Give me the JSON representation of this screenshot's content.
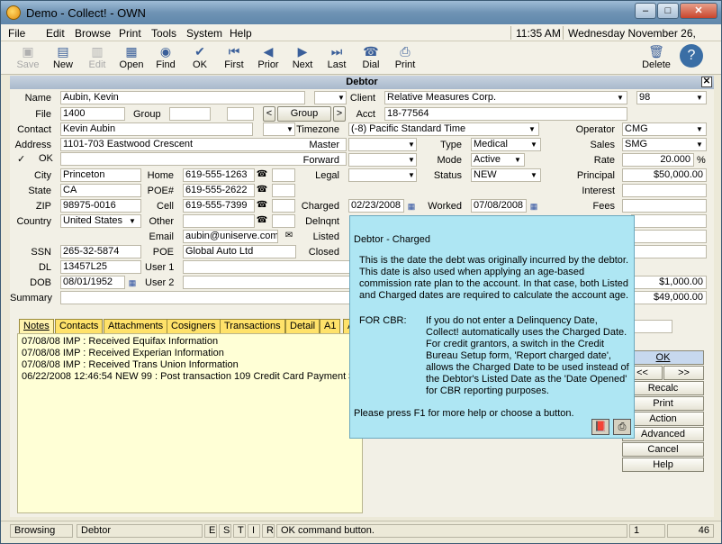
{
  "window": {
    "title": "Demo - Collect! - OWN",
    "min": "–",
    "max": "□",
    "close": "✕"
  },
  "menu": {
    "items": [
      "File",
      "Edit",
      "Browse",
      "Print",
      "Tools",
      "System",
      "Help"
    ],
    "time": "11:35 AM",
    "date": "Wednesday  November 26, 2008"
  },
  "toolbar": {
    "save": "Save",
    "new": "New",
    "edit": "Edit",
    "open": "Open",
    "find": "Find",
    "ok": "OK",
    "first": "First",
    "prior": "Prior",
    "next": "Next",
    "last": "Last",
    "dial": "Dial",
    "print": "Print",
    "delete": "Delete",
    "help": "?"
  },
  "panel": {
    "title": "Debtor",
    "close": "✕"
  },
  "labels": {
    "name": "Name",
    "file": "File",
    "group": "Group",
    "contact": "Contact",
    "address": "Address",
    "ok": "OK",
    "city": "City",
    "home": "Home",
    "state": "State",
    "poe_num": "POE#",
    "zip": "ZIP",
    "cell": "Cell",
    "country": "Country",
    "other": "Other",
    "email": "Email",
    "ssn": "SSN",
    "poe": "POE",
    "dl": "DL",
    "user1": "User 1",
    "dob": "DOB",
    "user2": "User 2",
    "summary": "Summary",
    "client": "Client",
    "acct": "Acct",
    "timezone": "Timezone",
    "master": "Master",
    "forward": "Forward",
    "legal": "Legal",
    "charged": "Charged",
    "delnqnt": "Delnqnt",
    "listed": "Listed",
    "closed": "Closed",
    "type": "Type",
    "mode": "Mode",
    "status": "Status",
    "worked": "Worked",
    "operator": "Operator",
    "sales": "Sales",
    "rate": "Rate",
    "principal": "Principal",
    "interest": "Interest",
    "fees": "Fees"
  },
  "values": {
    "name": "Aubin, Kevin",
    "file": "1400",
    "group_btn": "Group",
    "prev": "<",
    "next": ">",
    "contact": "Kevin Aubin",
    "address": "1101-703 Eastwood Crescent",
    "ok_check": "✓",
    "city": "Princeton",
    "home": "619-555-1263",
    "state": "CA",
    "poe_num": "619-555-2622",
    "zip": "98975-0016",
    "cell": "619-555-7399",
    "country": "United States",
    "email": "aubin@uniserve.com",
    "ssn": "265-32-5874",
    "poe": "Global Auto Ltd",
    "dl": "13457L25",
    "dob": "08/01/1952",
    "client": "Relative Measures Corp.",
    "client_num": "98",
    "acct": "18-77564",
    "timezone": "(-8) Pacific Standard Time",
    "charged": "02/23/2008",
    "type": "Medical",
    "mode": "Active",
    "status": "NEW",
    "worked": "07/08/2008",
    "operator": "CMG",
    "sales": "SMG",
    "rate": "20.000",
    "rate_unit": "%",
    "principal": "$50,000.00",
    "paid": "$1,000.00",
    "owing": "$49,000.00"
  },
  "tabs": [
    "Notes",
    "Contacts",
    "Attachments",
    "Cosigners",
    "Transactions",
    "Detail",
    "A1",
    "A"
  ],
  "notes": [
    "07/08/08 IMP : Received Equifax Information",
    "07/08/08 IMP : Received Experian Information",
    "07/08/08 IMP : Received Trans Union Information",
    "06/22/2008 12:46:54 NEW 99 : Post transaction 109 Credit Card Payment $1"
  ],
  "sidebuttons": {
    "ok": "OK",
    "prev": "<<",
    "next": ">>",
    "recalc": "Recalc",
    "print": "Print",
    "action": "Action",
    "advanced": "Advanced",
    "cancel": "Cancel",
    "help": "Help"
  },
  "popup": {
    "heading": "Debtor - Charged",
    "body": "This is the date the debt was originally incurred by the debtor. This date is also used when applying an age-based commission rate plan to the account. In that case, both Listed and Charged dates are required to calculate the account age.",
    "cbr_label": "FOR CBR:",
    "cbr_text": "If you do not enter a Delinquency Date, Collect! automatically uses the Charged Date. For credit grantors, a switch in the Credit Bureau Setup form, 'Report charged date', allows the Charged Date to be used instead of the Debtor's Listed Date as the 'Date Opened' for CBR reporting purposes.",
    "footer": "Please press F1 for more help or choose a button."
  },
  "status": {
    "mode": "Browsing",
    "form": "Debtor",
    "e": "E",
    "s": "S",
    "t": "T",
    "i": "I",
    "r": "R",
    "message": "OK command button.",
    "record": "1",
    "total": "46"
  }
}
